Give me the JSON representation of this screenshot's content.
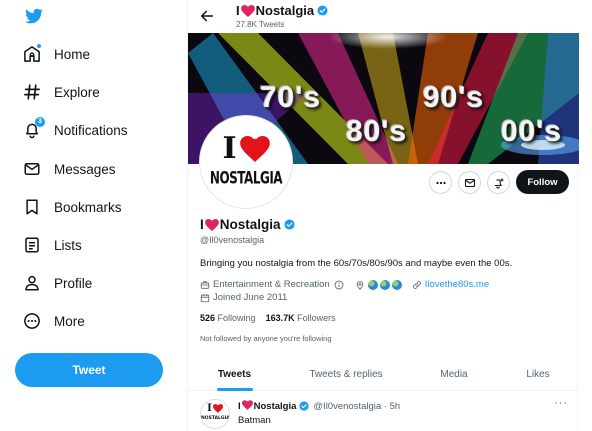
{
  "sidebar": {
    "items": [
      {
        "label": "Home",
        "icon": "home-icon"
      },
      {
        "label": "Explore",
        "icon": "hashtag-icon"
      },
      {
        "label": "Notifications",
        "icon": "bell-icon",
        "badge": "3"
      },
      {
        "label": "Messages",
        "icon": "envelope-icon"
      },
      {
        "label": "Bookmarks",
        "icon": "bookmark-icon"
      },
      {
        "label": "Lists",
        "icon": "list-icon"
      },
      {
        "label": "Profile",
        "icon": "person-icon"
      },
      {
        "label": "More",
        "icon": "more-circle-icon"
      }
    ],
    "tweet_label": "Tweet"
  },
  "header": {
    "name_prefix": "I",
    "name_suffix": "Nostalgia",
    "tweet_count": "27.8K Tweets"
  },
  "banner": {
    "labels": [
      "70's",
      "90's",
      "80's",
      "00's"
    ]
  },
  "avatar": {
    "line1": "I",
    "line2": "NOSTALGIA"
  },
  "profile": {
    "name_prefix": "I",
    "name_suffix": "Nostalgia",
    "handle": "@Il0venostalgia",
    "bio": "Bringing you nostalgia from the 60s/70s/80s/90s and maybe even the 00s.",
    "category": "Entertainment & Recreation",
    "website": "Ilovethe80s.me",
    "joined": "Joined June 2011",
    "following_count": "526",
    "following_label": "Following",
    "followers_count": "163.7K",
    "followers_label": "Followers",
    "not_followed": "Not followed by anyone you're following",
    "follow_label": "Follow"
  },
  "tabs": [
    {
      "label": "Tweets",
      "active": true
    },
    {
      "label": "Tweets & replies",
      "active": false
    },
    {
      "label": "Media",
      "active": false
    },
    {
      "label": "Likes",
      "active": false
    }
  ],
  "tweet": {
    "name_prefix": "I",
    "name_suffix": "Nostalgia",
    "handle_time": "@Il0venostalgia · 5h",
    "text": "Batman",
    "more": "···"
  },
  "colors": {
    "accent": "#1d9bf0",
    "heart": "#e0245e",
    "text": "#0f1419",
    "muted": "#536471"
  }
}
